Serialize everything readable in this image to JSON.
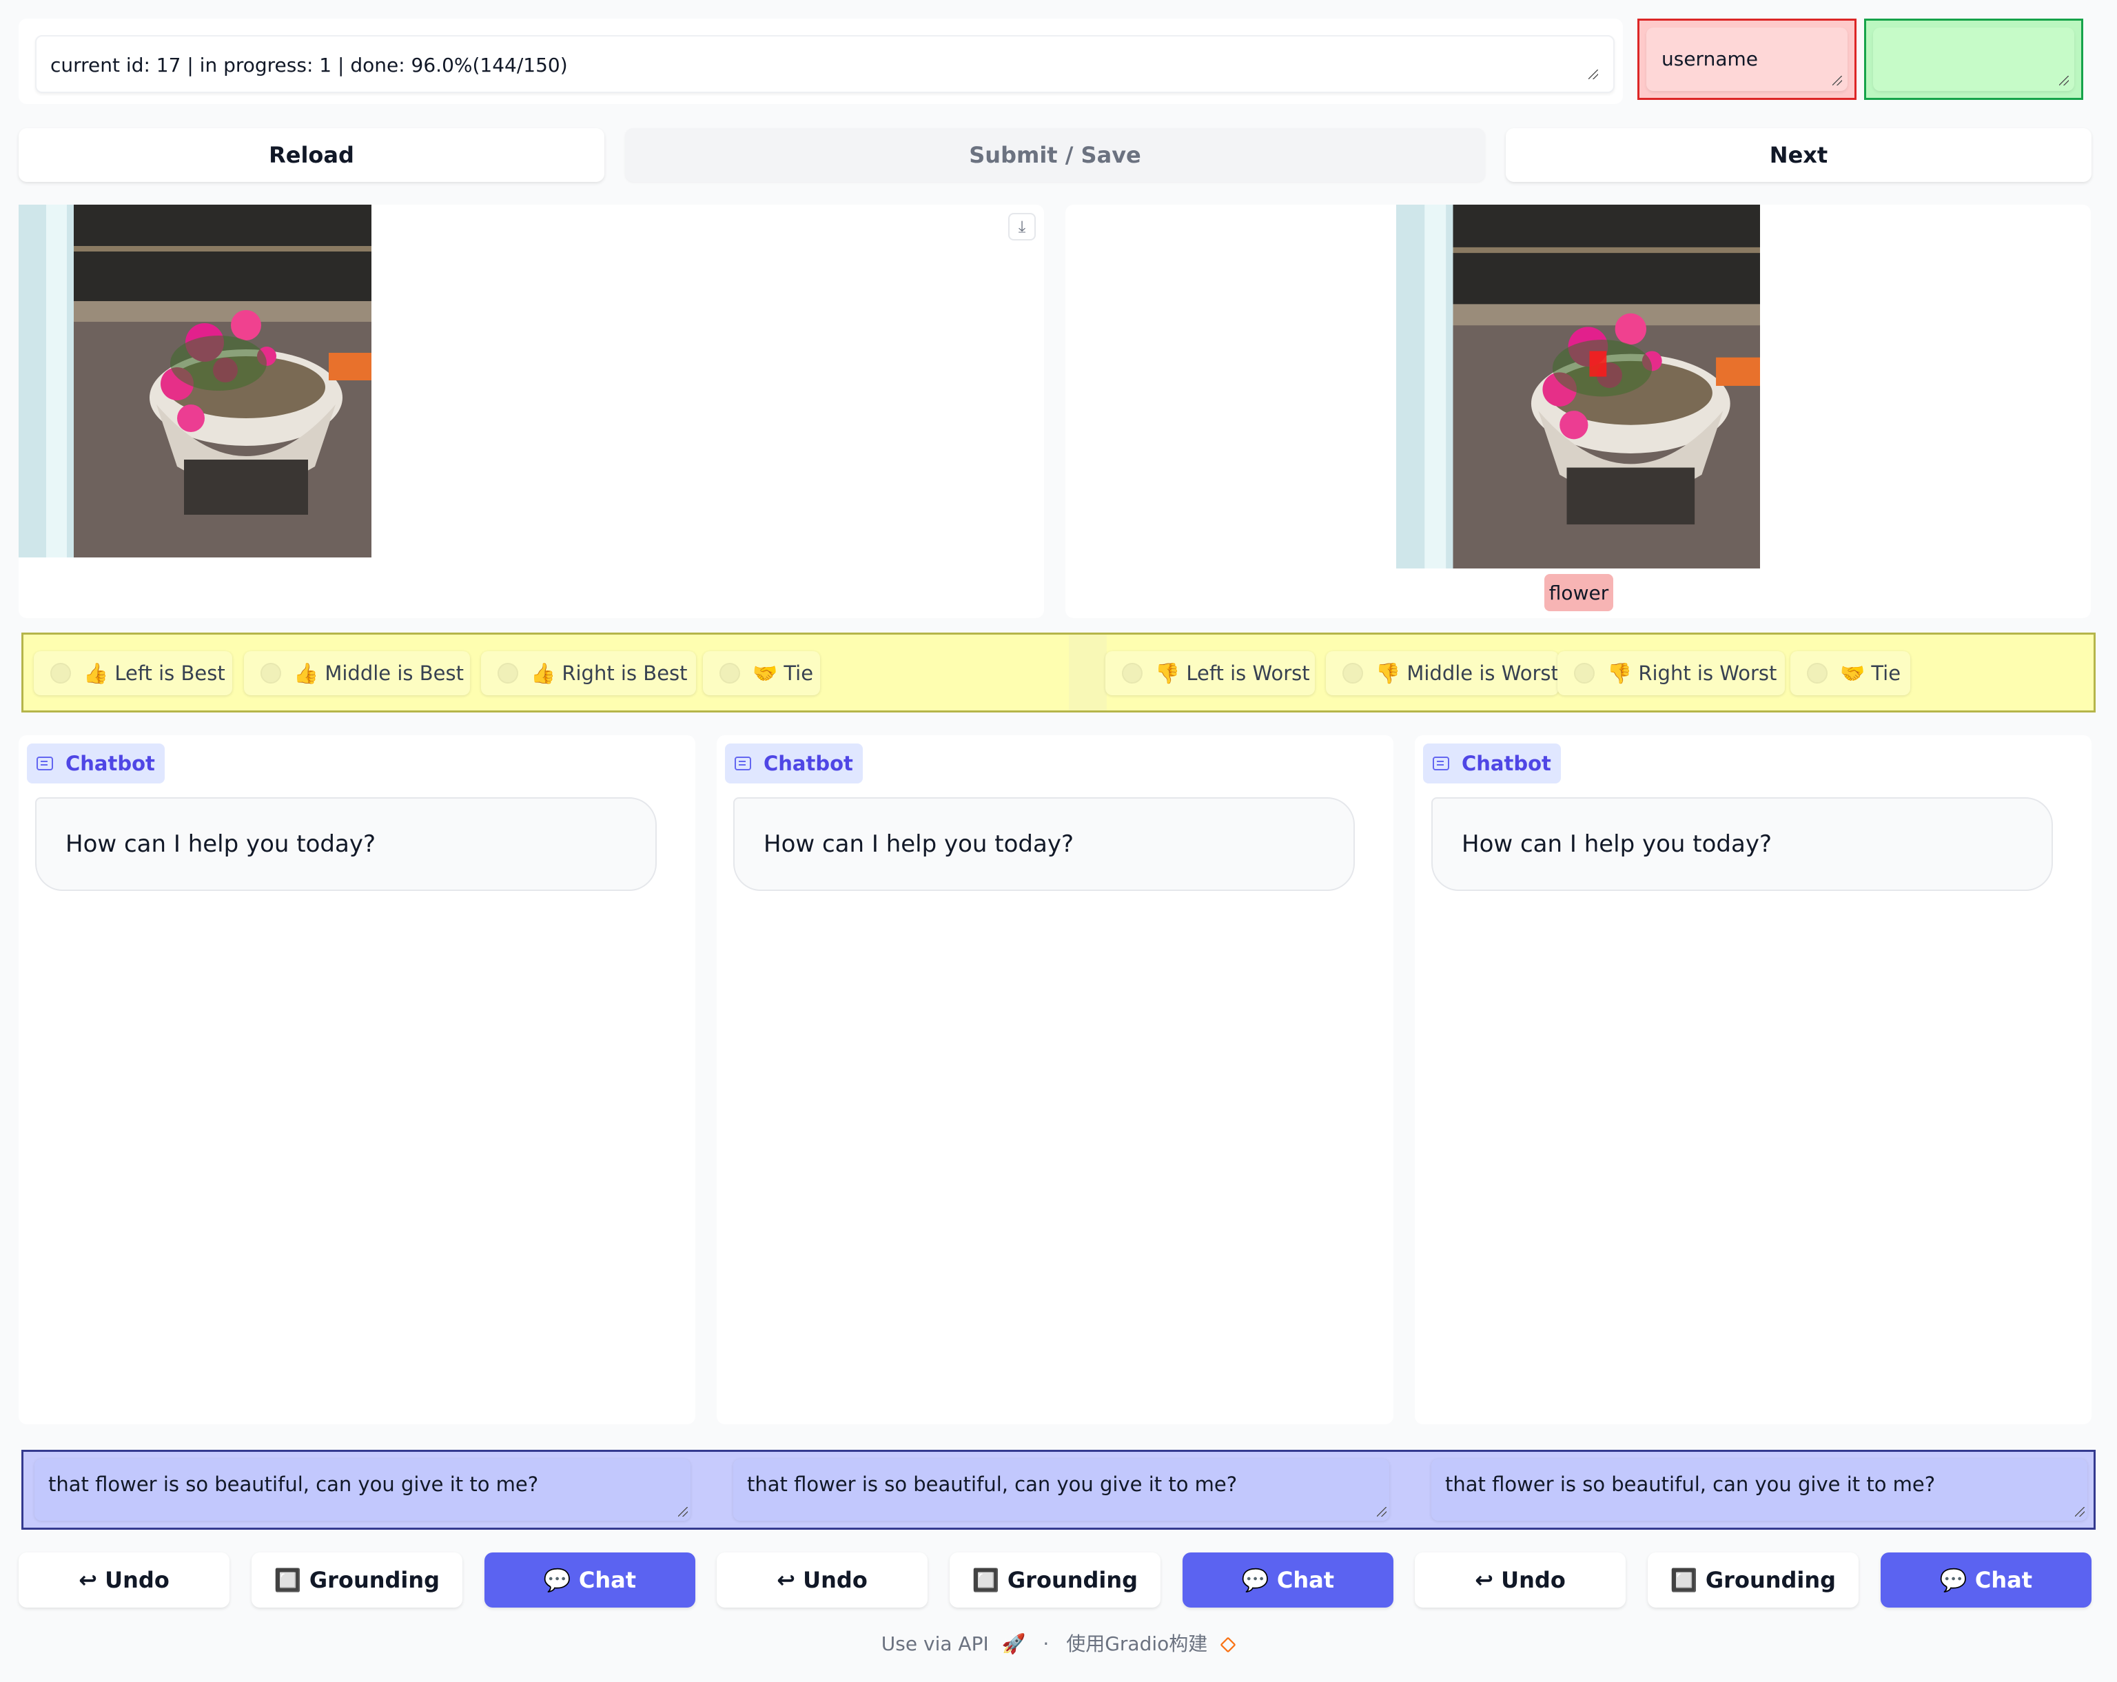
{
  "status": {
    "progress_text": "current id: 17 | in progress: 1 | done: 96.0%(144/150)",
    "username_placeholder": "username",
    "extra_value": ""
  },
  "toolbar": {
    "reload_label": "Reload",
    "submit_label": "Submit / Save",
    "next_label": "Next"
  },
  "images": {
    "left_download_icon": "download-icon",
    "right_label": "flower"
  },
  "voting": {
    "best": [
      "👍 Left is Best",
      "👍 Middle is Best",
      "👍 Right is Best",
      "🤝 Tie"
    ],
    "worst": [
      "👎 Left is Worst",
      "👎 Middle is Worst",
      "👎 Right is Worst",
      "🤝 Tie"
    ]
  },
  "chatbots": [
    {
      "label": "Chatbot",
      "message": "How can I help you today?"
    },
    {
      "label": "Chatbot",
      "message": "How can I help you today?"
    },
    {
      "label": "Chatbot",
      "message": "How can I help you today?"
    }
  ],
  "inputs": [
    "that flower is so beautiful, can you give it to me?",
    "that flower is so beautiful, can you give it to me?",
    "that flower is so beautiful, can you give it to me?"
  ],
  "controls": [
    {
      "undo": "↩ Undo",
      "grounding": "🔲 Grounding",
      "chat": "💬 Chat"
    },
    {
      "undo": "↩ Undo",
      "grounding": "🔲 Grounding",
      "chat": "💬 Chat"
    },
    {
      "undo": "↩ Undo",
      "grounding": "🔲 Grounding",
      "chat": "💬 Chat"
    }
  ],
  "footer": {
    "api_link": "Use via API",
    "api_icon": "🚀",
    "separator": "·",
    "built_with": "使用Gradio构建",
    "gradio_icon": "gradio-logo-icon"
  },
  "colors": {
    "accent": "#5b63f1",
    "username_bg": "#fecaca",
    "username_border": "#dc2626",
    "green_bg": "#bbf7c0",
    "vote_bg": "#fefeb0",
    "input_bg": "#c7cbfd",
    "label_chip": "#f7b4b4"
  }
}
